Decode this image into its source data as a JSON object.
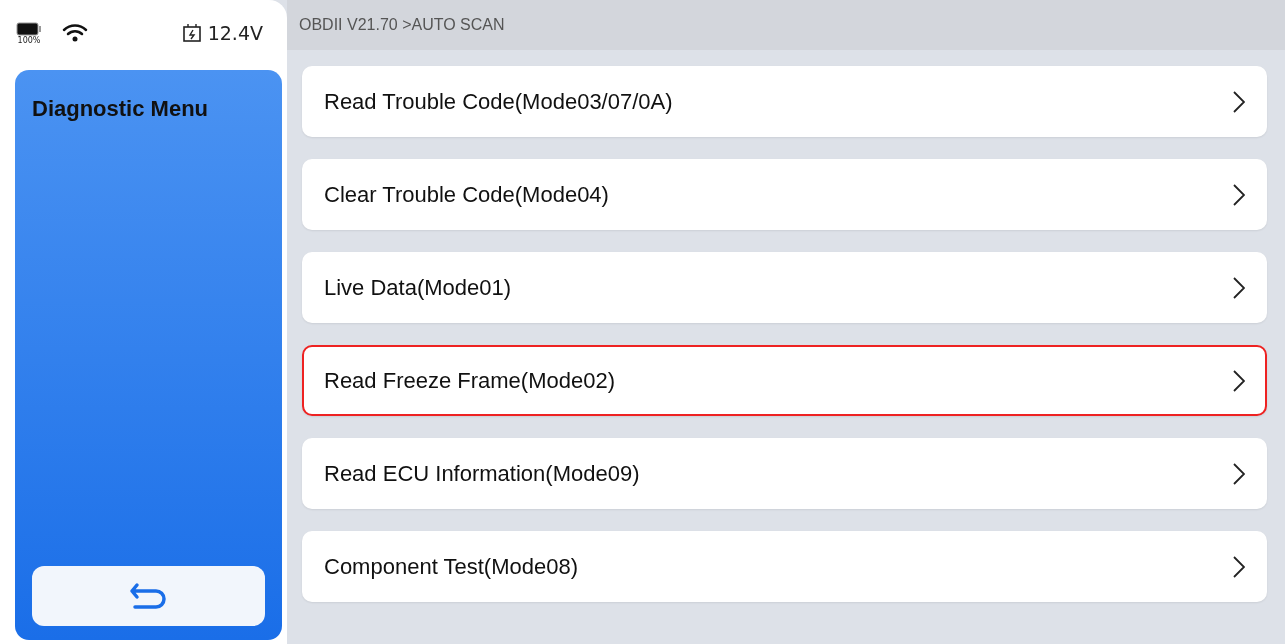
{
  "status_bar": {
    "battery": "100%",
    "voltage": "12.4V"
  },
  "breadcrumb": "OBDII V21.70 >AUTO SCAN",
  "sidebar": {
    "title": "Diagnostic Menu"
  },
  "menu_items": [
    {
      "label": "Read Trouble Code(Mode03/07/0A)",
      "highlighted": false
    },
    {
      "label": "Clear Trouble Code(Mode04)",
      "highlighted": false
    },
    {
      "label": "Live Data(Mode01)",
      "highlighted": false
    },
    {
      "label": "Read Freeze Frame(Mode02)",
      "highlighted": true
    },
    {
      "label": "Read ECU Information(Mode09)",
      "highlighted": false
    },
    {
      "label": "Component Test(Mode08)",
      "highlighted": false
    }
  ]
}
